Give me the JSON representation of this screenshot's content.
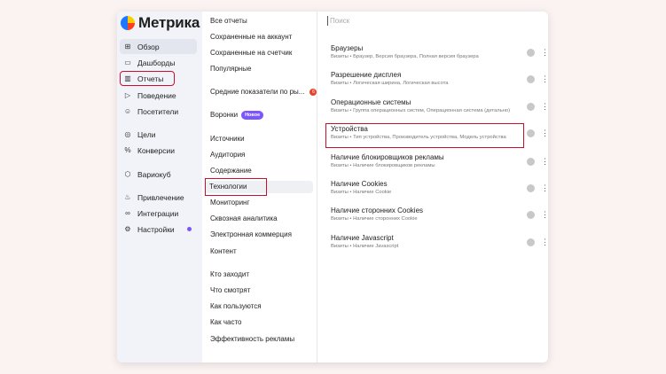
{
  "app": {
    "title": "Метрика"
  },
  "sidebar": {
    "items": [
      {
        "label": "Обзор",
        "icon": "grid-icon"
      },
      {
        "label": "Дашборды",
        "icon": "dashboard-icon"
      },
      {
        "label": "Отчеты",
        "icon": "bar-chart-icon"
      },
      {
        "label": "Поведение",
        "icon": "play-icon"
      },
      {
        "label": "Посетители",
        "icon": "user-icon"
      },
      {
        "label": "Цели",
        "icon": "target-icon"
      },
      {
        "label": "Конверсии",
        "icon": "percent-icon"
      },
      {
        "label": "Вариокуб",
        "icon": "cube-icon"
      },
      {
        "label": "Привлечение",
        "icon": "flame-icon"
      },
      {
        "label": "Интеграции",
        "icon": "link-icon"
      },
      {
        "label": "Настройки",
        "icon": "gear-icon"
      }
    ]
  },
  "middle": {
    "items": [
      "Все отчеты",
      "Сохраненные на аккаунт",
      "Сохраненные на счетчик",
      "Популярные",
      "Средние показатели по ры...",
      "Воронки",
      "Источники",
      "Аудитория",
      "Содержание",
      "Технологии",
      "Мониторинг",
      "Сквозная аналитика",
      "Электронная коммерция",
      "Контент",
      "Кто заходит",
      "Что смотрят",
      "Как пользуются",
      "Как часто",
      "Эффективность рекламы"
    ],
    "new_badge": "Новое",
    "count_badge": "6"
  },
  "right": {
    "search_placeholder": "Поиск",
    "reports": [
      {
        "title": "Браузеры",
        "subtitle": "Визиты • Браузер, Версия браузера, Полная версия браузера"
      },
      {
        "title": "Разрешение дисплея",
        "subtitle": "Визиты • Логическая ширина, Логическая высота"
      },
      {
        "title": "Операционные системы",
        "subtitle": "Визиты • Группа операционных систем, Операционная система (детально)"
      },
      {
        "title": "Устройства",
        "subtitle": "Визиты • Тип устройства, Производитель устройства, Модель устройства"
      },
      {
        "title": "Наличие блокировщиков рекламы",
        "subtitle": "Визиты • Наличие блокировщиков рекламы"
      },
      {
        "title": "Наличие Cookies",
        "subtitle": "Визиты • Наличие Cookie"
      },
      {
        "title": "Наличие сторонних Cookies",
        "subtitle": "Визиты • Наличие сторонних Cookie"
      },
      {
        "title": "Наличие Javascript",
        "subtitle": "Визиты • Наличие Javascript"
      }
    ]
  },
  "colors": {
    "accent": "#7d55ff",
    "highlight": "#c8102e",
    "sidebar_bg": "#f1f3f8"
  }
}
